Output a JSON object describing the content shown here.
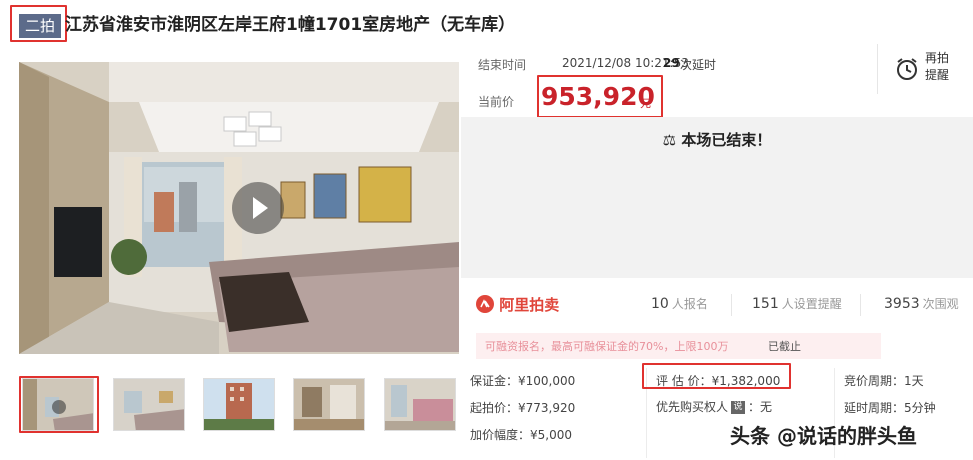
{
  "header": {
    "tag": "二拍",
    "title": "江苏省淮安市淮阴区左岸王府1幢1701室房地产（无车库）"
  },
  "auction": {
    "end_label": "结束时间",
    "end_time": "2021/12/08 10:21:53",
    "delay_count": "29",
    "delay_label": "次延时",
    "current_price_label": "当前价",
    "current_price": "953,920",
    "price_unit": "元",
    "remind_label": "再拍提醒",
    "ended_text": "本场已结束！"
  },
  "stats": {
    "brand": "阿里拍卖",
    "signups": "10",
    "signups_unit": "人报名",
    "reminders": "151",
    "reminders_unit": "人设置提醒",
    "views": "3953",
    "views_unit": "次围观"
  },
  "notice": {
    "text": "可融资报名，最高可融保证金的70%，上限100万",
    "status": "已截止"
  },
  "details": {
    "deposit": "保证金：¥100,000",
    "start_price": "起拍价：¥773,920",
    "increment": "加价幅度：¥5,000",
    "appraisal": "评 估 价：¥1,382,000",
    "priority_label": "优先购买权人",
    "priority_tag": "说",
    "priority_value": "：无",
    "cycle": "竞价周期：1天",
    "delay_cycle": "延时周期：5分钟"
  },
  "watermark": "头条 @说话的胖头鱼"
}
